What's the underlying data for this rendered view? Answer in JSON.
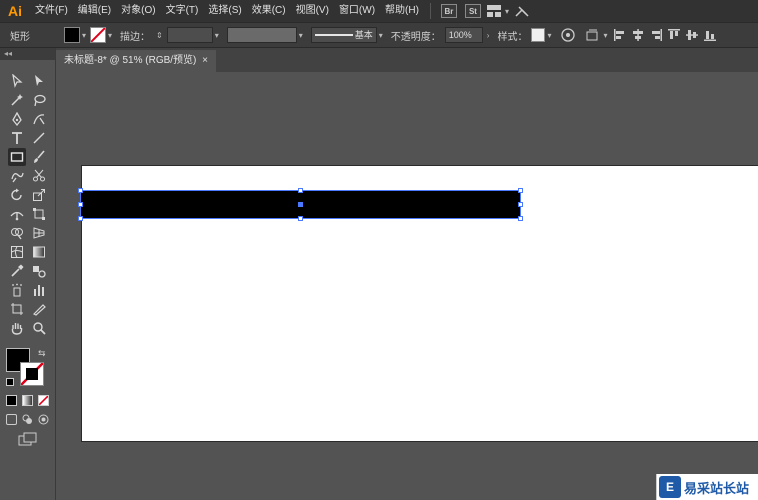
{
  "app": {
    "logo": "Ai"
  },
  "menu": {
    "items": [
      "文件(F)",
      "编辑(E)",
      "对象(O)",
      "文字(T)",
      "选择(S)",
      "效果(C)",
      "视图(V)",
      "窗口(W)",
      "帮助(H)"
    ],
    "badges": [
      "Br",
      "St"
    ]
  },
  "control": {
    "tool_name": "矩形",
    "stroke_label": "描边：",
    "stroke_style": "基本",
    "opacity_label": "不透明度：",
    "opacity_value": "100%",
    "style_label": "样式："
  },
  "document": {
    "tab_title": "未标题-8* @ 51% (RGB/预览)",
    "tab_close": "×"
  },
  "toolbox": {
    "collapse": "◂◂"
  },
  "watermark": {
    "logo": "E",
    "text": "易采站长站"
  },
  "colors": {
    "app_logo": "#ff9a00",
    "selection": "#4a78ff",
    "rect_fill": "#000000",
    "artboard": "#ffffff",
    "workspace": "#535353"
  }
}
